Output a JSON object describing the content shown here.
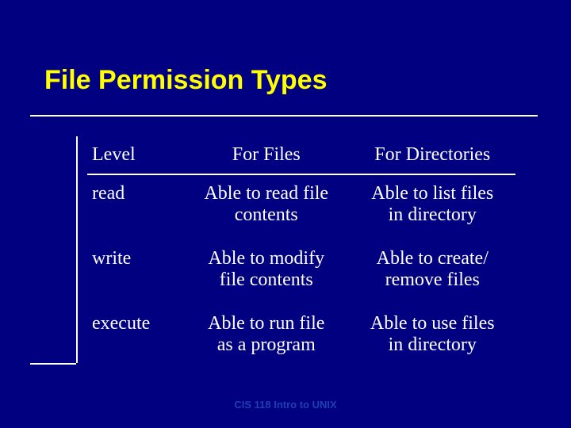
{
  "title": "File Permission Types",
  "table": {
    "headers": {
      "level": "Level",
      "files": "For Files",
      "dirs": "For Directories"
    },
    "rows": [
      {
        "level": "read",
        "files_l1": "Able to read file",
        "files_l2": "contents",
        "dirs_l1": "Able to list files",
        "dirs_l2": "in directory"
      },
      {
        "level": "write",
        "files_l1": "Able to modify",
        "files_l2": "file contents",
        "dirs_l1": "Able to create/",
        "dirs_l2": "remove files"
      },
      {
        "level": "execute",
        "files_l1": "Able to run file",
        "files_l2": "as a program",
        "dirs_l1": "Able to use files",
        "dirs_l2": "in directory"
      }
    ]
  },
  "footer": "CIS 118 Intro to UNIX"
}
